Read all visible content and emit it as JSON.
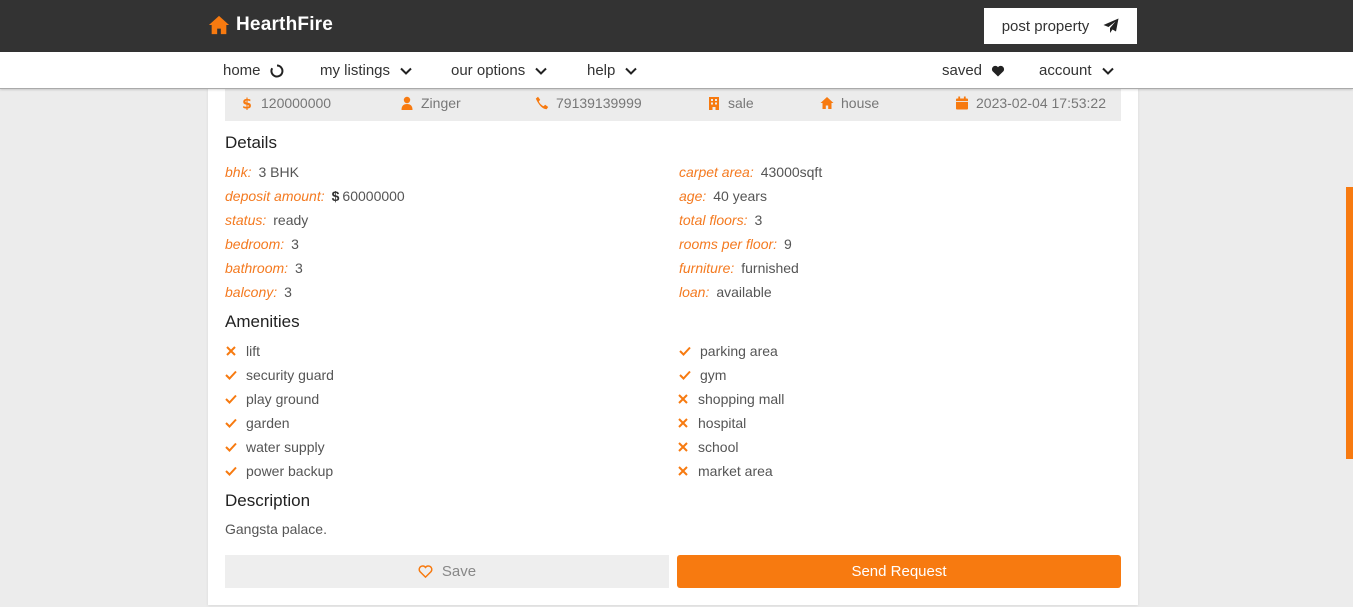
{
  "brand": {
    "name": "HearthFire"
  },
  "header": {
    "post_label": "post property"
  },
  "nav": {
    "home": "home",
    "my_listings": "my listings",
    "our_options": "our options",
    "help": "help",
    "saved": "saved",
    "account": "account"
  },
  "listing": {
    "price": "120000000",
    "owner": "Zinger",
    "phone": "79139139999",
    "type": "sale",
    "category": "house",
    "posted": "2023-02-04 17:53:22"
  },
  "details": {
    "title": "Details",
    "left": [
      {
        "label": "bhk:",
        "value": "3 BHK"
      },
      {
        "label": "deposit amount:",
        "currency": "$",
        "value": "60000000"
      },
      {
        "label": "status:",
        "value": "ready"
      },
      {
        "label": "bedroom:",
        "value": "3"
      },
      {
        "label": "bathroom:",
        "value": "3"
      },
      {
        "label": "balcony:",
        "value": "3"
      }
    ],
    "right": [
      {
        "label": "carpet area:",
        "value": "43000sqft"
      },
      {
        "label": "age:",
        "value": "40 years"
      },
      {
        "label": "total floors:",
        "value": "3"
      },
      {
        "label": "rooms per floor:",
        "value": "9"
      },
      {
        "label": "furniture:",
        "value": "furnished"
      },
      {
        "label": "loan:",
        "value": "available"
      }
    ]
  },
  "amenities": {
    "title": "Amenities",
    "left": [
      {
        "name": "lift",
        "available": false
      },
      {
        "name": "security guard",
        "available": true
      },
      {
        "name": "play ground",
        "available": true
      },
      {
        "name": "garden",
        "available": true
      },
      {
        "name": "water supply",
        "available": true
      },
      {
        "name": "power backup",
        "available": true
      }
    ],
    "right": [
      {
        "name": "parking area",
        "available": true
      },
      {
        "name": "gym",
        "available": true
      },
      {
        "name": "shopping mall",
        "available": false
      },
      {
        "name": "hospital",
        "available": false
      },
      {
        "name": "school",
        "available": false
      },
      {
        "name": "market area",
        "available": false
      }
    ]
  },
  "description": {
    "title": "Description",
    "text": "Gangsta palace."
  },
  "actions": {
    "save_label": "Save",
    "send_label": "Send Request"
  },
  "colors": {
    "accent": "#f77a10",
    "topbar": "#333333",
    "background": "#ececec"
  }
}
